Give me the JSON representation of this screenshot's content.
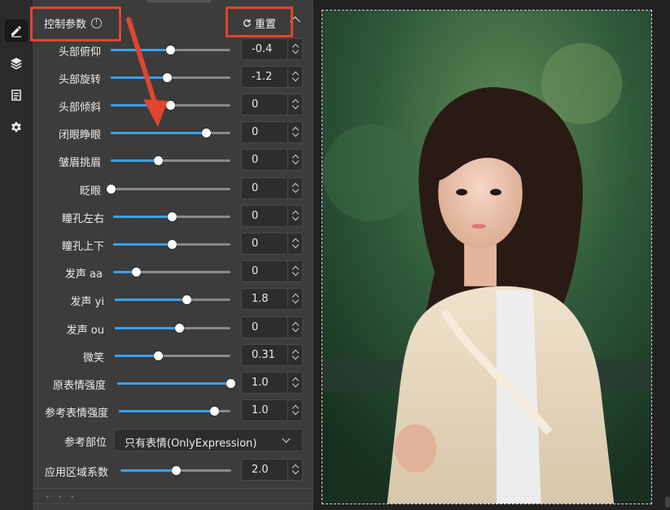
{
  "panel": {
    "title": "控制参数",
    "info_icon": "info-circle-icon",
    "reset_label": "重置",
    "reset_icon": "refresh-icon"
  },
  "rail": [
    "pencil-icon",
    "layers-icon",
    "clipboard-icon",
    "gear-icon"
  ],
  "controls": [
    {
      "label": "头部俯仰",
      "value": "-0.4",
      "fraction": 0.5
    },
    {
      "label": "头部旋转",
      "value": "-1.2",
      "fraction": 0.47
    },
    {
      "label": "头部倾斜",
      "value": "0",
      "fraction": 0.5
    },
    {
      "label": "闭眼睁眼",
      "value": "0",
      "fraction": 0.8
    },
    {
      "label": "皱眉挑眉",
      "value": "0",
      "fraction": 0.4
    },
    {
      "label": "眨眼",
      "value": "0",
      "fraction": 0.0
    },
    {
      "label": "瞳孔左右",
      "value": "0",
      "fraction": 0.5
    },
    {
      "label": "瞳孔上下",
      "value": "0",
      "fraction": 0.5
    },
    {
      "label": "发声 aa",
      "value": "0",
      "fraction": 0.2
    },
    {
      "label": "发声 yi",
      "value": "1.8",
      "fraction": 0.62
    },
    {
      "label": "发声 ou",
      "value": "0",
      "fraction": 0.56
    },
    {
      "label": "微笑",
      "value": "0.31",
      "fraction": 0.38
    },
    {
      "label": "原表情强度",
      "value": "1.0",
      "fraction": 1.0
    },
    {
      "label": "参考表情强度",
      "value": "1.0",
      "fraction": 0.86
    }
  ],
  "reference_part": {
    "label": "参考部位",
    "selected": "只有表情(OnlyExpression)"
  },
  "region_factor": {
    "label": "应用区域系数",
    "value": "2.0",
    "fraction": 0.5
  },
  "colors": {
    "accent": "#3aa0f0",
    "annotation": "#e2452f",
    "panel_bg": "#3c3c3c"
  }
}
